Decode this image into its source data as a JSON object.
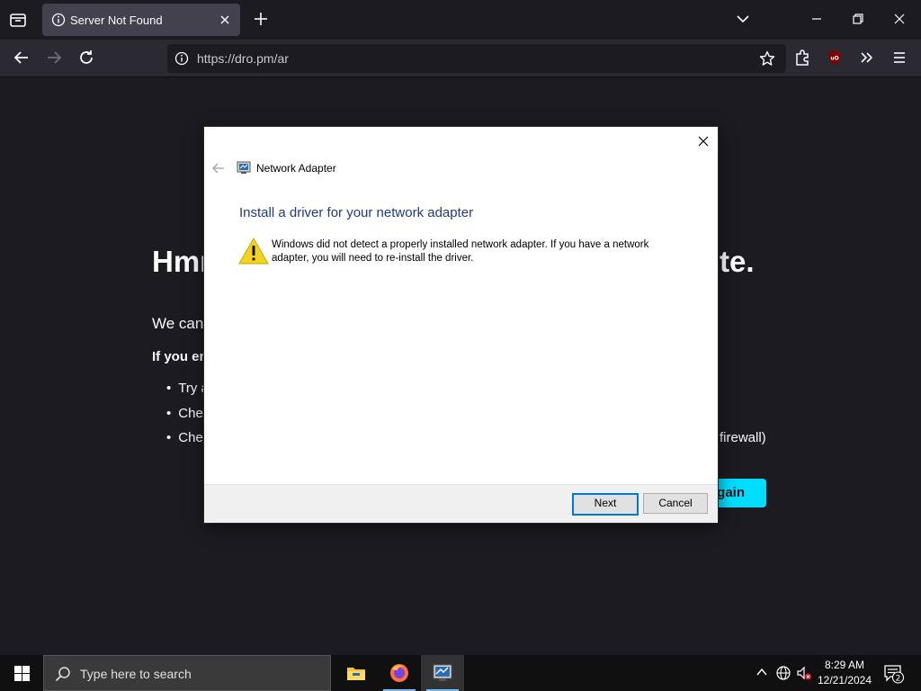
{
  "browser": {
    "tab_title": "Server Not Found",
    "url": "https://dro.pm/ar"
  },
  "error_page": {
    "title_start": "Hmm",
    "title_end": "te.",
    "subtitle": "We can’",
    "list_heading": "If you en",
    "items": [
      "Try a",
      "Chec",
      "Chec"
    ],
    "item3_end": "firewall)",
    "try_again_label": "gain"
  },
  "dialog": {
    "app_title": "Network Adapter",
    "heading": "Install a driver for your network adapter",
    "message": "Windows did not detect a properly installed network adapter. If you have a network adapter, you will need to re-install the driver.",
    "next_label": "Next",
    "cancel_label": "Cancel"
  },
  "taskbar": {
    "search_placeholder": "Type here to search",
    "time": "8:29 AM",
    "date": "12/21/2024",
    "notification_count": "2"
  },
  "colors": {
    "accent_cyan": "#00ddff",
    "dialog_heading": "#1e3b8a",
    "focus_border": "#0078d7"
  }
}
